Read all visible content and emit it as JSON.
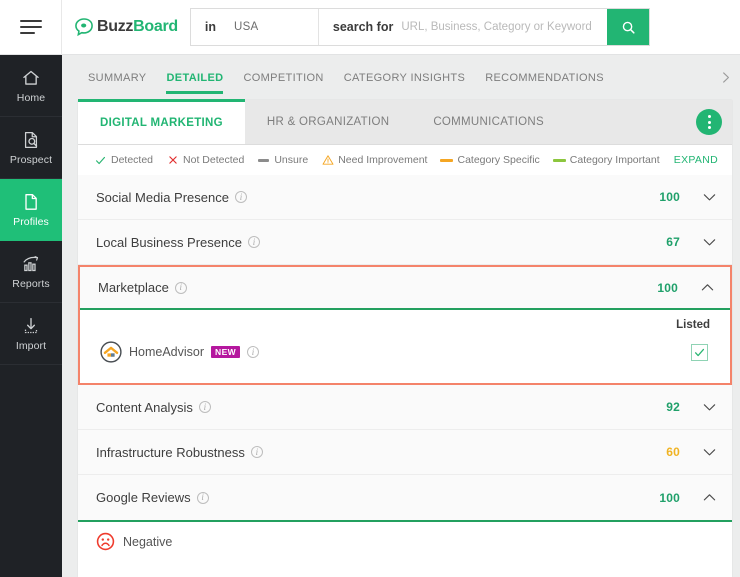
{
  "colors": {
    "brand_green": "#22b573",
    "sidebar_bg": "#1f2226",
    "highlight_border": "#f4836a",
    "score_green": "#1fa06a",
    "score_amber": "#f0b323",
    "badge_magenta": "#b5179e",
    "legend_orange": "#f5a623",
    "legend_green": "#8cc63e",
    "negative_red": "#ef3b2d"
  },
  "topbar": {
    "menu_icon": "hamburger-menu-icon",
    "logo": {
      "icon": "buzzboard-speech-bubble-icon",
      "text_part1": "Buzz",
      "text_part2": "Board"
    },
    "search": {
      "in_label": "in",
      "country_value": "USA",
      "search_for_label": "search for",
      "placeholder": "URL, Business, Category or Keyword",
      "input_value": "",
      "button_icon": "search-icon"
    }
  },
  "sidebar": {
    "items": [
      {
        "label": "Home",
        "icon": "home-icon",
        "active": false
      },
      {
        "label": "Prospect",
        "icon": "prospect-icon",
        "active": false
      },
      {
        "label": "Profiles",
        "icon": "profiles-icon",
        "active": true
      },
      {
        "label": "Reports",
        "icon": "reports-icon",
        "active": false
      },
      {
        "label": "Import",
        "icon": "import-icon",
        "active": false
      }
    ]
  },
  "tabs": {
    "items": [
      {
        "label": "SUMMARY",
        "active": false
      },
      {
        "label": "DETAILED",
        "active": true
      },
      {
        "label": "COMPETITION",
        "active": false
      },
      {
        "label": "CATEGORY INSIGHTS",
        "active": false
      },
      {
        "label": "RECOMMENDATIONS",
        "active": false
      }
    ],
    "scroll_icon": "chevron-right-icon"
  },
  "subtabs": {
    "items": [
      {
        "label": "DIGITAL MARKETING",
        "active": true
      },
      {
        "label": "HR & ORGANIZATION",
        "active": false
      },
      {
        "label": "COMMUNICATIONS",
        "active": false
      }
    ],
    "menu_icon": "kebab-menu-icon"
  },
  "legend": {
    "items": [
      {
        "label": "Detected",
        "mark": "check-green-icon"
      },
      {
        "label": "Not Detected",
        "mark": "cross-red-icon"
      },
      {
        "label": "Unsure",
        "mark": "dash-gray-icon"
      },
      {
        "label": "Need Improvement",
        "mark": "warning-triangle-icon"
      },
      {
        "label": "Category Specific",
        "mark": "bar-orange-icon"
      },
      {
        "label": "Category Important",
        "mark": "bar-green-icon"
      }
    ],
    "expand_label": "EXPAND"
  },
  "accordion": {
    "rows": [
      {
        "title": "Social Media Presence",
        "score": "100",
        "score_color": "#1fa06a",
        "expanded": false,
        "chevron": "chevron-down-icon"
      },
      {
        "title": "Local Business Presence",
        "score": "67",
        "score_color": "#1fa06a",
        "expanded": false,
        "chevron": "chevron-down-icon"
      },
      {
        "title": "Marketplace",
        "score": "100",
        "score_color": "#1fa06a",
        "expanded": true,
        "chevron": "chevron-up-icon",
        "highlighted": true
      },
      {
        "title": "Content Analysis",
        "score": "92",
        "score_color": "#1fa06a",
        "expanded": false,
        "chevron": "chevron-down-icon"
      },
      {
        "title": "Infrastructure Robustness",
        "score": "60",
        "score_color": "#f0b323",
        "expanded": false,
        "chevron": "chevron-down-icon"
      },
      {
        "title": "Google Reviews",
        "score": "100",
        "score_color": "#1fa06a",
        "expanded": true,
        "chevron": "chevron-up-icon"
      }
    ],
    "marketplace": {
      "column_header": "Listed",
      "vendor": {
        "name": "HomeAdvisor",
        "logo_icon": "homeadvisor-house-logo-icon",
        "badge": "NEW",
        "info_icon": "info-icon",
        "listed_checked": true,
        "checkbox_icon": "check-icon"
      }
    },
    "google_reviews": {
      "sentiment_label": "Negative",
      "sentiment_icon": "frowning-face-icon"
    }
  }
}
